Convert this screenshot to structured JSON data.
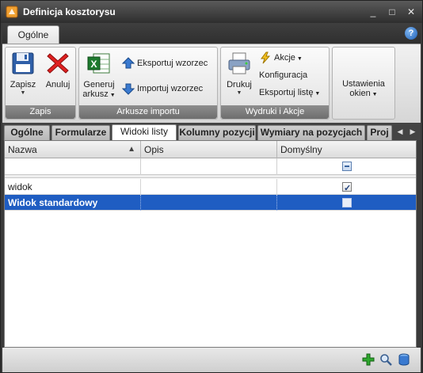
{
  "window": {
    "title": "Definicja kosztorysu",
    "controls": {
      "minimize": "_",
      "maximize": "□",
      "close": "✕"
    }
  },
  "ribbon": {
    "tabs": [
      {
        "label": "Ogólne"
      }
    ],
    "help_label": "?",
    "groups": {
      "zapis": {
        "caption": "Zapis",
        "save_line1": "Zapisz",
        "cancel_label": "Anuluj"
      },
      "arkusze": {
        "caption": "Arkusze importu",
        "generate_line1": "Generuj",
        "generate_line2": "arkusz",
        "export_template": "Eksportuj wzorzec",
        "import_template": "Importuj wzorzec"
      },
      "wydruki": {
        "caption": "Wydruki i Akcje",
        "print_label": "Drukuj",
        "actions_label": "Akcje",
        "configuration_label": "Konfiguracja",
        "export_list_label": "Eksportuj listę"
      },
      "ustawienia": {
        "line1": "Ustawienia",
        "line2": "okien"
      }
    }
  },
  "subtabs": [
    "Ogólne",
    "Formularze",
    "Widoki listy",
    "Kolumny pozycji",
    "Wymiary na pozycjach",
    "Proj"
  ],
  "active_subtab": "Widoki listy",
  "grid": {
    "columns": [
      "Nazwa",
      "Opis",
      "Domyślny"
    ],
    "rows": [
      {
        "name": "widok",
        "description": "",
        "default": true,
        "selected": false
      },
      {
        "name": "Widok standardowy",
        "description": "",
        "default": false,
        "selected": true
      }
    ]
  },
  "icons": {
    "app": "kosztorys-app-icon",
    "save": "floppy-disk-icon",
    "cancel": "red-x-icon",
    "generate": "excel-sheet-icon",
    "export": "upload-arrow-icon",
    "import": "download-arrow-icon",
    "print": "printer-icon",
    "actions": "lightning-icon",
    "add": "green-plus-icon",
    "search": "magnifier-icon",
    "database": "database-icon"
  },
  "colors": {
    "titlebar": "#3b3b3b",
    "selection": "#1f5dc2",
    "caption_bar": "#7a7a7a"
  }
}
